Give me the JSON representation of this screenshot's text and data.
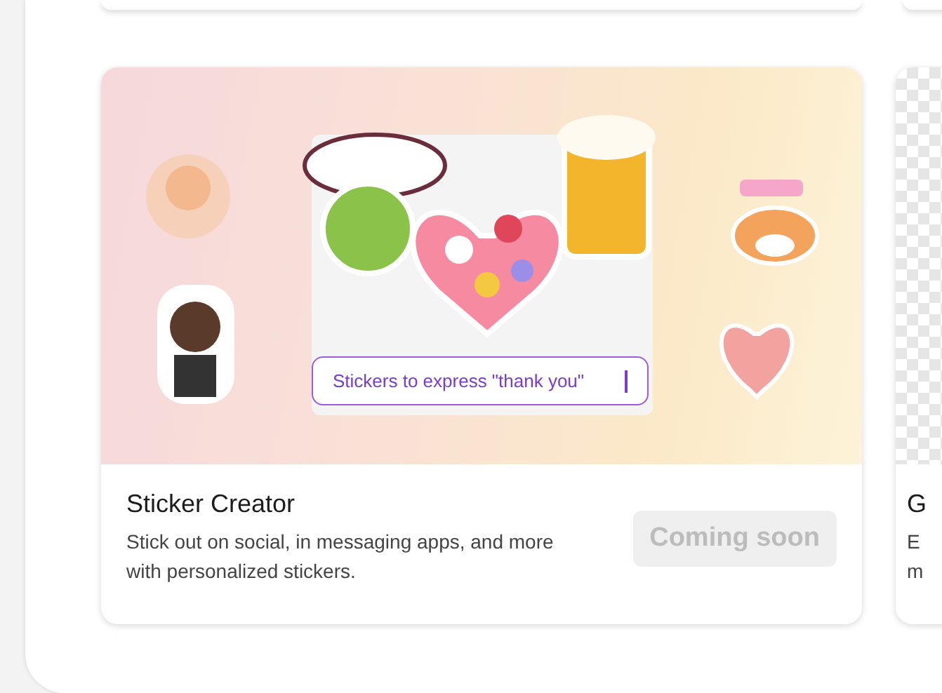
{
  "cards": [
    {
      "kind": "artwork",
      "title": "Sticker Creator",
      "description": "Stick out on social, in messaging apps, and more with personalized stickers.",
      "prompt": {
        "value": "Stickers to express \"thank you\""
      },
      "button": {
        "label": "Coming soon",
        "disabled": true
      }
    },
    {
      "kind": "checkered",
      "title": "G",
      "description_lines": [
        "E",
        "m"
      ]
    }
  ]
}
